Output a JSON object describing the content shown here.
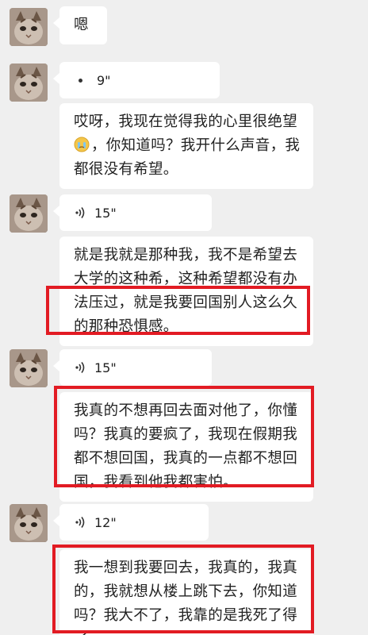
{
  "messages": [
    {
      "type": "text",
      "text": "嗯"
    },
    {
      "type": "voice",
      "duration": "9\""
    },
    {
      "type": "text",
      "text_a": "哎呀，我现在觉得我的心里很绝望",
      "emoji": "crying-face-emoji",
      "text_b": "，你知道吗？我开什么声音，我都很没有希望。"
    },
    {
      "type": "voice",
      "duration": "15\""
    },
    {
      "type": "text",
      "text": "就是我就是那种我，我不是希望去大学的这种希，这种希望都没有办法压过，就是我要回国别人这么久的那种恐惧感。"
    },
    {
      "type": "voice",
      "duration": "15\""
    },
    {
      "type": "text",
      "text": "我真的不想再回去面对他了，你懂吗？我真的要疯了，我现在假期我都不想回国，我真的一点都不想回国，我看到他我都害怕。"
    },
    {
      "type": "voice",
      "duration": "12\""
    },
    {
      "type": "text",
      "text": "我一想到我要回去，我真的，我真的，我就想从楼上跳下去，你知道吗？我大不了，我靠的是我死了得了。"
    }
  ],
  "colors": {
    "background": "#efefef",
    "bubble": "#ffffff",
    "highlight": "#e21b23"
  }
}
